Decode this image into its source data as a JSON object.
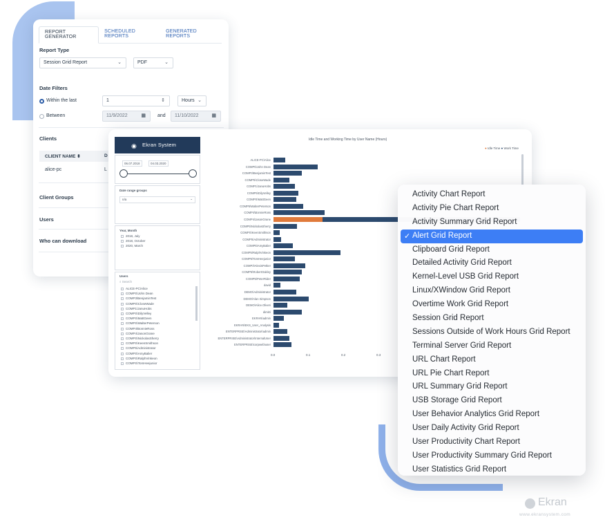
{
  "tabs": [
    "REPORT GENERATOR",
    "SCHEDULED REPORTS",
    "GENERATED REPORTS"
  ],
  "report_type": {
    "label": "Report Type",
    "value": "Session Grid Report",
    "format": "PDF"
  },
  "date_filters": {
    "label": "Date Filters",
    "within_label": "Within the last",
    "within_value": "1",
    "unit": "Hours",
    "between_label": "Between",
    "from": "11/9/2022",
    "and_label": "and",
    "to": "11/10/2022"
  },
  "clients": {
    "label": "Clients",
    "col_name": "CLIENT NAME",
    "col_d": "D",
    "row_name": "alice-pc",
    "row_d": "L"
  },
  "sections": {
    "client_groups": "Client Groups",
    "users": "Users",
    "who_can_download": "Who can download"
  },
  "dashboard": {
    "brand": "Ekran System",
    "date_from": "06.07.2018",
    "date_to": "04.03.2020",
    "date_range_groups_label": "Date range groups",
    "date_range_groups_value": "n/a",
    "year_month_label": "Year, Month",
    "year_month_items": [
      "2018, July",
      "2018, October",
      "2020, March"
    ],
    "users_label": "Users",
    "users_search": "Search",
    "users_list": [
      "ALICE-PC\\Alice",
      "COMPS\\John Dean",
      "COMP3\\BenjaminTest",
      "COMPS\\CloseWade",
      "COMP1\\JanuHobs",
      "COMPS\\DilyVelley",
      "COMPS\\MattGeen",
      "COMPS\\WalterPeterson",
      "COMP4\\BonnieRoss",
      "COMP4\\JasonGrane",
      "COMPS\\NickolasSherry",
      "COMPS\\KeenSmithson",
      "COMP5\\Administrator",
      "COMPS\\AmyBalier",
      "COMPS\\RalphVinkeon",
      "COMPS\\TomHeejunior"
    ]
  },
  "chart_data": {
    "type": "bar",
    "title": "Idle Time and Working Time by User Name (Hours)",
    "series": [
      {
        "name": "Idle Time",
        "color": "#e07a3b"
      },
      {
        "name": "Work Time",
        "color": "#2c4a6e"
      }
    ],
    "categories": [
      "ALICE-PC\\Alice",
      "COMP5\\John Dean",
      "COMP3\\BenjaminTest",
      "COMP5\\CloseWade",
      "COMP1\\JanuHobs",
      "COMP5\\DilyVelley",
      "COMPS\\MattGeen",
      "COMP5\\WalterPeterson",
      "COMP4\\BonnieRoss",
      "COMP4\\JasonGrane",
      "COMP5\\NickolasSherry",
      "COMPS\\KeenSmithson",
      "COMP5\\Administrator",
      "COMP5\\AmyBalier",
      "COMP5\\RalphVinkeon",
      "COMP5\\TomHeejunior",
      "COMP3\\AlexisPetker",
      "COMP5\\RobertOakley",
      "COMP5\\PeterRider",
      "david",
      "DEMO\\Administrator",
      "DEMO\\Alan Simpson",
      "DEMO\\Alice.Oliveri",
      "dimitri",
      "EKRAN\\admin",
      "EKRAN\\EKS_User_Analysis",
      "ENTERPRISE\\Administrator\\admin",
      "ENTERPRISE\\Administrator\\InternalUser",
      "ENTERPRISE\\corpweb\\user"
    ],
    "work": [
      0.034,
      0.125,
      0.08,
      0.045,
      0.06,
      0.07,
      0.065,
      0.085,
      0.145,
      0.56,
      0.067,
      0.018,
      0.021,
      0.055,
      0.19,
      0.06,
      0.09,
      0.08,
      0.075,
      0.02,
      0.065,
      0.1,
      0.04,
      0.08,
      0.03,
      0.015,
      0.04,
      0.045,
      0.05
    ],
    "idle": [
      0,
      0,
      0,
      0,
      0,
      0,
      0,
      0,
      0,
      0.14,
      0,
      0,
      0,
      0,
      0,
      0,
      0,
      0,
      0,
      0,
      0,
      0,
      0,
      0,
      0,
      0,
      0,
      0,
      0
    ],
    "xticks": [
      "0.0",
      "0.1",
      "0.2",
      "0.3"
    ]
  },
  "dropdown": {
    "selected_index": 3,
    "check_icon": "checkmark-icon",
    "options": [
      "Activity Chart Report",
      "Activity Pie Chart Report",
      "Activity Summary Grid Report",
      "Alert Grid Report",
      "Clipboard Grid Report",
      "Detailed Activity Grid Report",
      "Kernel-Level USB Grid Report",
      "Linux/XWindow Grid Report",
      "Overtime Work Grid Report",
      "Session Grid Report",
      "Sessions Outside of Work Hours Grid Report",
      "Terminal Server Grid Report",
      "URL Chart Report",
      "URL Pie Chart Report",
      "URL Summary Grid Report",
      "USB Storage Grid Report",
      "User Behavior Analytics Grid Report",
      "User Daily Activity Grid Report",
      "User Productivity Chart Report",
      "User Productivity Summary Grid Report",
      "User Statistics Grid Report"
    ]
  },
  "footer": {
    "logo": "Ekran",
    "url": "www.ekransystem.com"
  }
}
